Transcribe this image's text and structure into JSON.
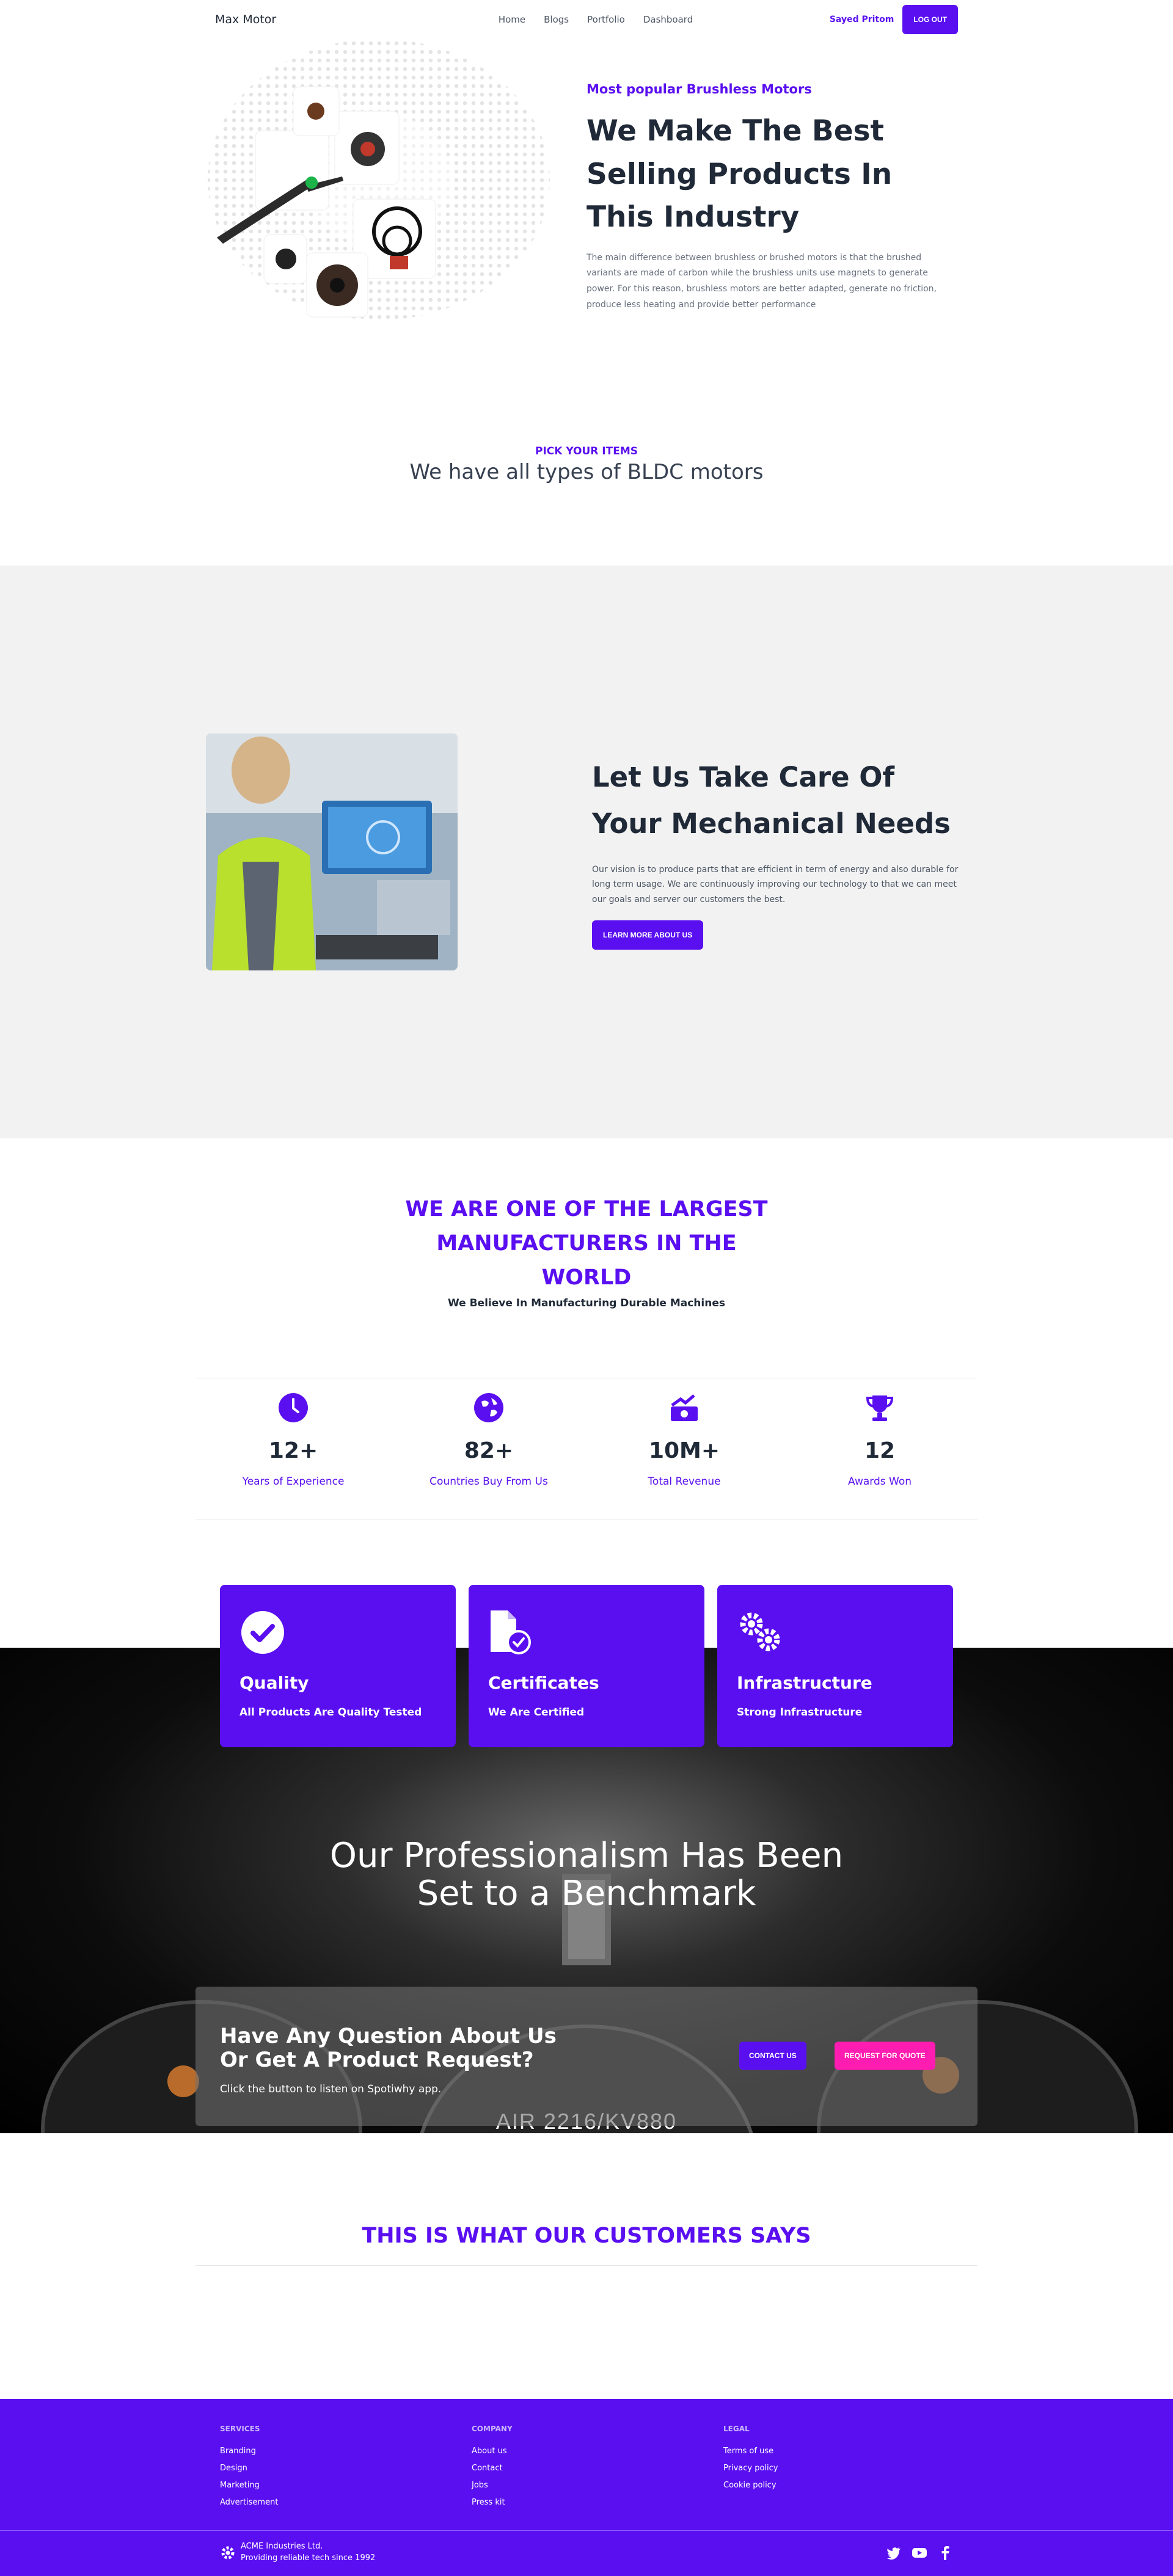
{
  "nav": {
    "brand": "Max Motor",
    "links": [
      "Home",
      "Blogs",
      "Portfolio",
      "Dashboard"
    ],
    "user": "Sayed Pritom",
    "logout": "LOG OUT"
  },
  "hero": {
    "kicker": "Most popular Brushless Motors",
    "title": "We Make The Best Selling Products In This Industry",
    "desc": "The main difference between brushless or brushed motors is that the brushed variants are made of carbon while the brushless units use magnets to generate power. For this reason, brushless motors are better adapted, generate no friction, produce less heating and provide better performance"
  },
  "pick": {
    "kicker": "PICK YOUR ITEMS",
    "title": "We have all types of BLDC motors"
  },
  "care": {
    "title": "Let Us Take Care Of Your Mechanical Needs",
    "desc": "Our vision is to produce parts that are efficient in term of energy and also durable for long term usage. We are continuously improving our technology to that we can meet our goals and server our customers the best.",
    "button": "LEARN MORE ABOUT US"
  },
  "manufacturers": {
    "title": "WE ARE ONE OF THE LARGEST MANUFACTURERS IN THE WORLD",
    "subtitle": "We Believe In Manufacturing Durable Machines"
  },
  "stats": [
    {
      "icon": "clock-icon",
      "value": "12+",
      "label": "Years of Experience"
    },
    {
      "icon": "globe-icon",
      "value": "82+",
      "label": "Countries Buy From Us"
    },
    {
      "icon": "revenue-icon",
      "value": "10M+",
      "label": "Total Revenue"
    },
    {
      "icon": "trophy-icon",
      "value": "12",
      "label": "Awards Won"
    }
  ],
  "features": [
    {
      "icon": "check-circle-icon",
      "title": "Quality",
      "subtitle": "All Products Are Quality Tested"
    },
    {
      "icon": "certificate-icon",
      "title": "Certificates",
      "subtitle": "We Are Certified"
    },
    {
      "icon": "gears-icon",
      "title": "Infrastructure",
      "subtitle": "Strong Infrastructure"
    }
  ],
  "benchmark": {
    "line1": "Our Professionalism Has Been",
    "line2": "Set to a Benchmark",
    "motor_text": "AIR 2216/KV880"
  },
  "cta": {
    "title_line1": "Have Any Question About Us",
    "title_line2": "Or Get A Product Request?",
    "subtitle": "Click the button to listen on Spotiwhy app.",
    "contact": "CONTACT US",
    "quote": "REQUEST FOR QUOTE"
  },
  "testimonials": {
    "title": "THIS IS WHAT OUR CUSTOMERS SAYS"
  },
  "footer": {
    "columns": [
      {
        "title": "SERVICES",
        "links": [
          "Branding",
          "Design",
          "Marketing",
          "Advertisement"
        ]
      },
      {
        "title": "COMPANY",
        "links": [
          "About us",
          "Contact",
          "Jobs",
          "Press kit"
        ]
      },
      {
        "title": "LEGAL",
        "links": [
          "Terms of use",
          "Privacy policy",
          "Cookie policy"
        ]
      }
    ],
    "company": "ACME Industries Ltd.",
    "tagline": "Providing reliable tech since 1992"
  },
  "colors": {
    "accent": "#5a0ff0",
    "pink": "#ff1cb0",
    "gray_bg": "#f2f2f2"
  }
}
